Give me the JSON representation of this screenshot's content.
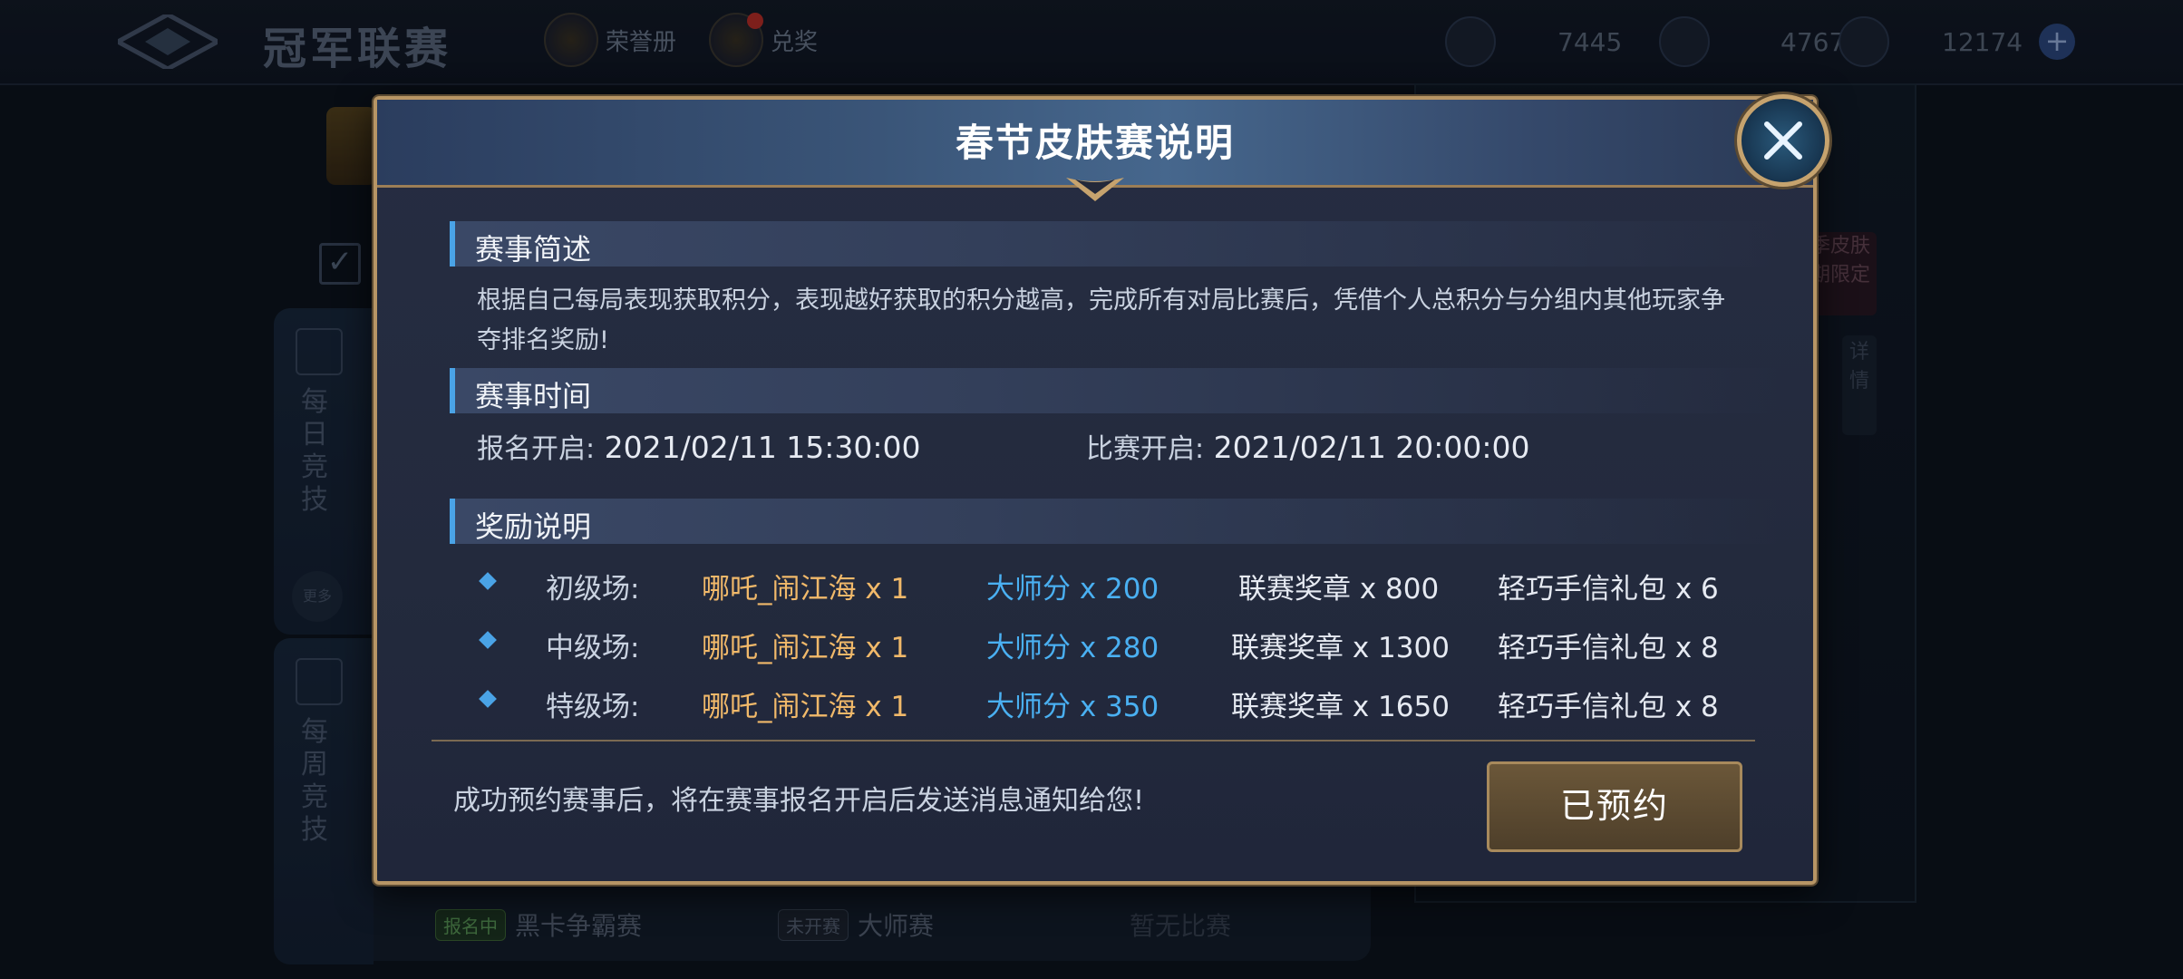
{
  "topbar": {
    "title": "冠军联赛",
    "honor_label": "荣誉册",
    "redeem_label": "兑奖",
    "currencies": [
      {
        "icon": "medal-icon",
        "value": "7445"
      },
      {
        "icon": "card-icon",
        "value": "4767"
      },
      {
        "icon": "diamond-icon",
        "value": "12174"
      }
    ],
    "plus_symbol": "+"
  },
  "background": {
    "daily_label": "每日竞技",
    "weekly_label": "每周竞技",
    "more_label": "更多",
    "tag1": "报名中",
    "event1": "黑卡争霸赛",
    "tag2": "未开赛",
    "event2": "大师赛",
    "event3": "暂无比赛",
    "right_tab": "季皮肤\n期限定",
    "detail_tab": "详情"
  },
  "modal": {
    "title": "春节皮肤赛说明",
    "section1": "赛事简述",
    "description": "根据自己每局表现获取积分，表现越好获取的积分越高，完成所有对局比赛后，凭借个人总积分与分组内其他玩家争夺排名奖励!",
    "section2": "赛事时间",
    "signup_label": "报名开启:",
    "signup_time": "2021/02/11 15:30:00",
    "match_label": "比赛开启:",
    "match_time": "2021/02/11 20:00:00",
    "section3": "奖励说明",
    "rewards": [
      {
        "level": "初级场:",
        "skin": "哪吒_闹江海 x 1",
        "master": "大师分 x 200",
        "medal": "联赛奖章 x 800",
        "gift": "轻巧手信礼包 x 6"
      },
      {
        "level": "中级场:",
        "skin": "哪吒_闹江海 x 1",
        "master": "大师分 x 280",
        "medal": "联赛奖章 x 1300",
        "gift": "轻巧手信礼包 x 8"
      },
      {
        "level": "特级场:",
        "skin": "哪吒_闹江海 x 1",
        "master": "大师分 x 350",
        "medal": "联赛奖章 x 1650",
        "gift": "轻巧手信礼包 x 8"
      }
    ],
    "notice": "成功预约赛事后，将在赛事报名开启后发送消息通知给您!",
    "reserved_button": "已预约"
  },
  "colors": {
    "accent_blue": "#4aa3e6",
    "skin_gold": "#f1b96a",
    "master_blue": "#4ab0f2",
    "border_gold": "#b79565"
  }
}
